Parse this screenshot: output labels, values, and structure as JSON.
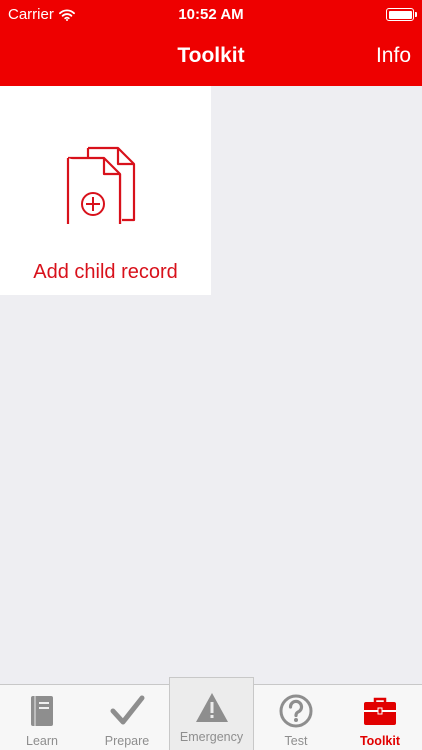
{
  "status_bar": {
    "carrier": "Carrier",
    "time": "10:52 AM",
    "battery_level": 1.0
  },
  "nav": {
    "title": "Toolkit",
    "info_label": "Info"
  },
  "tiles": [
    {
      "label": "Add child record",
      "icon": "add-document-icon"
    }
  ],
  "tabs": [
    {
      "label": "Learn",
      "icon": "book-icon"
    },
    {
      "label": "Prepare",
      "icon": "checkmark-icon"
    },
    {
      "label": "Emergency",
      "icon": "warning-icon"
    },
    {
      "label": "Test",
      "icon": "question-icon"
    },
    {
      "label": "Toolkit",
      "icon": "toolbox-icon",
      "active": true
    }
  ],
  "colors": {
    "brand_red": "#ee0000",
    "label_red": "#d8111b",
    "background": "#eeeef2",
    "tab_inactive": "#8e8e8e"
  }
}
